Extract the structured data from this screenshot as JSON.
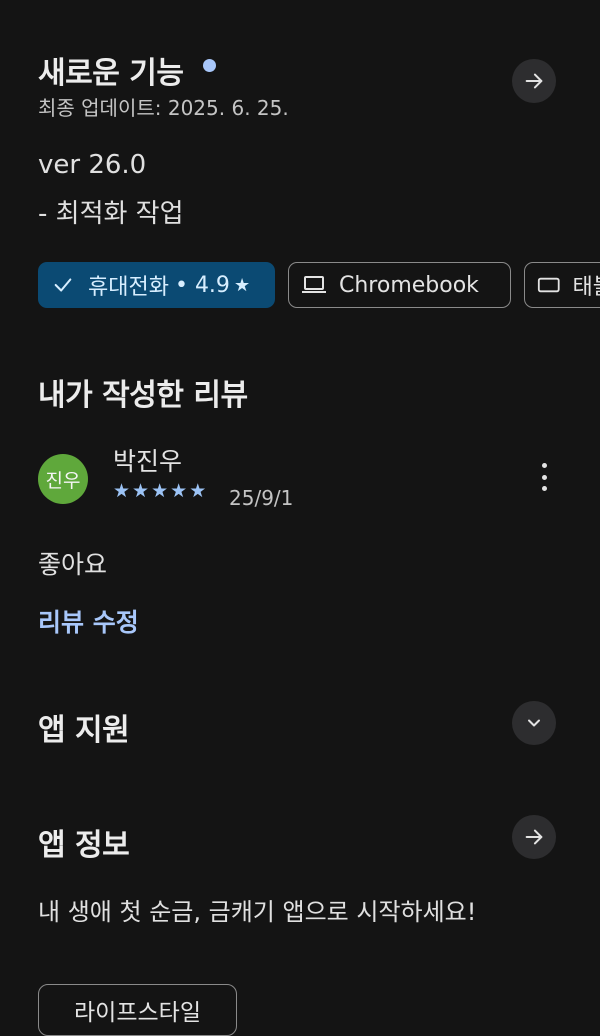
{
  "whats_new": {
    "title": "새로운 기능",
    "updated": "최종 업데이트: 2025. 6. 25.",
    "version": "ver 26.0",
    "notes": "- 최적화 작업",
    "dot_color": "#a8c7fa"
  },
  "device_chips": [
    {
      "label": "휴대전화",
      "rating": "• 4.9",
      "selected": true,
      "icon": "check-icon"
    },
    {
      "label": "Chromebook",
      "selected": false,
      "icon": "laptop-icon"
    },
    {
      "label": "태블",
      "selected": false,
      "icon": "tablet-icon"
    }
  ],
  "my_review": {
    "title": "내가 작성한 리뷰",
    "avatar_text": "진우",
    "avatar_color": "#5fa83b",
    "author": "박진우",
    "stars": 5,
    "date": "25/9/1",
    "body": "좋아요",
    "edit_label": "리뷰 수정"
  },
  "app_support": {
    "title": "앱 지원"
  },
  "app_info": {
    "title": "앱 정보",
    "description": "내 생애 첫 순금, 금캐기 앱으로 시작하세요!",
    "tag": "라이프스타일"
  },
  "colors": {
    "background": "#141414",
    "accent_link": "#a8c7fa",
    "selected_chip": "#0b4a73"
  }
}
